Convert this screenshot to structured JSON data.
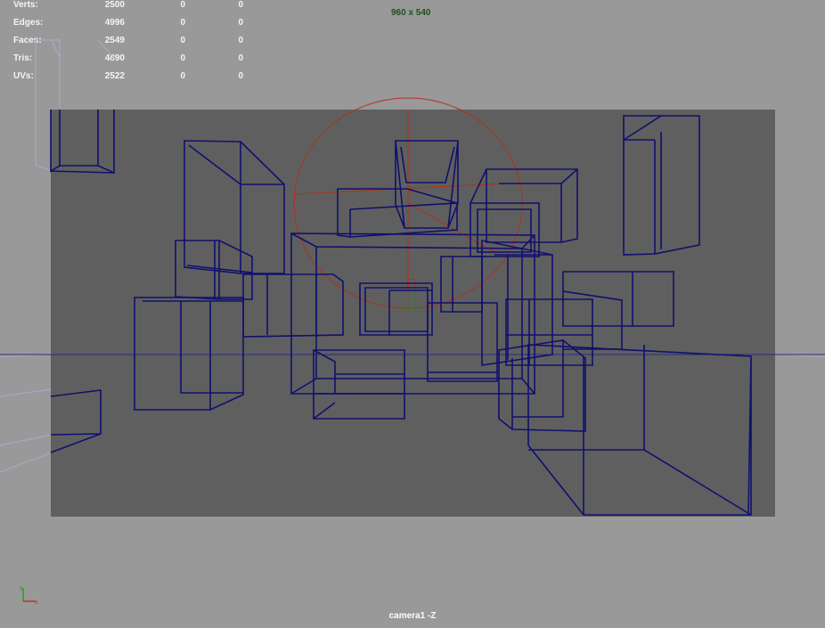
{
  "hud": {
    "rows": [
      {
        "label": "Verts:",
        "value": "2500",
        "selected": "0",
        "uv": "0"
      },
      {
        "label": "Edges:",
        "value": "4996",
        "selected": "0",
        "uv": "0"
      },
      {
        "label": "Faces:",
        "value": "2549",
        "selected": "0",
        "uv": "0"
      },
      {
        "label": "Tris:",
        "value": "4890",
        "selected": "0",
        "uv": "0"
      },
      {
        "label": "UVs:",
        "value": "2522",
        "selected": "0",
        "uv": "0"
      }
    ]
  },
  "resolution_gate": {
    "label": "960 x 540"
  },
  "camera": {
    "label": "camera1 -Z"
  },
  "colors": {
    "viewport_bg": "#999999",
    "gate_bg": "#5f5f5f",
    "wireframe": "#10106e",
    "pivot": "#b0301a",
    "resolution_text": "#1f4f1f"
  },
  "icons": {
    "axis": "view-axis-gizmo-icon"
  }
}
